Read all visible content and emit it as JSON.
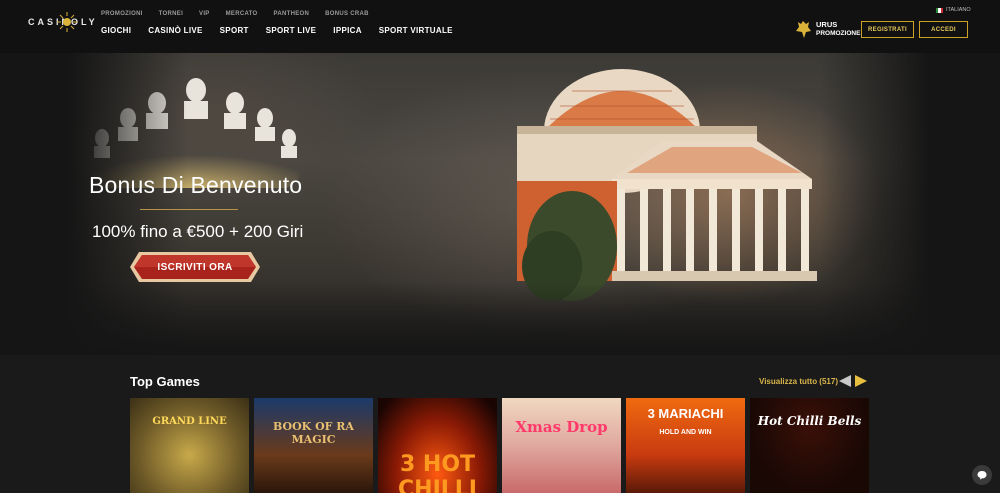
{
  "brand": {
    "logo_text": "CASINOLY"
  },
  "topnav": [
    "PROMOZIONI",
    "TORNEI",
    "VIP",
    "MERCATO",
    "PANTHEON",
    "BONUS CRAB"
  ],
  "mainnav": [
    "GIOCHI",
    "CASINÒ LIVE",
    "SPORT",
    "SPORT LIVE",
    "IPPICA",
    "SPORT VIRTUALE"
  ],
  "language": {
    "label": "ITALIANO"
  },
  "promo": {
    "line1": "URUS",
    "line2": "PROMOZIONE"
  },
  "auth": {
    "register": "REGISTRATI",
    "login": "ACCEDI"
  },
  "hero": {
    "title": "Bonus Di Benvenuto",
    "subtitle": "100% fino a €500 + 200 Giri",
    "cta": "ISCRIVITI ORA"
  },
  "top_games": {
    "heading": "Top Games",
    "view_all": "Visualizza tutto (517)",
    "games": [
      {
        "title": "GRAND LINE"
      },
      {
        "title": "BOOK OF RA MAGIC"
      },
      {
        "title": "3 HOT CHILLI"
      },
      {
        "title": "Xmas Drop"
      },
      {
        "title": "3 MARIACHI",
        "subtitle": "HOLD AND WIN"
      },
      {
        "title": "Hot Chilli Bells"
      }
    ]
  },
  "colors": {
    "accent_gold": "#c9a227",
    "cta_red": "#a8231c",
    "header_bg": "#111111"
  }
}
